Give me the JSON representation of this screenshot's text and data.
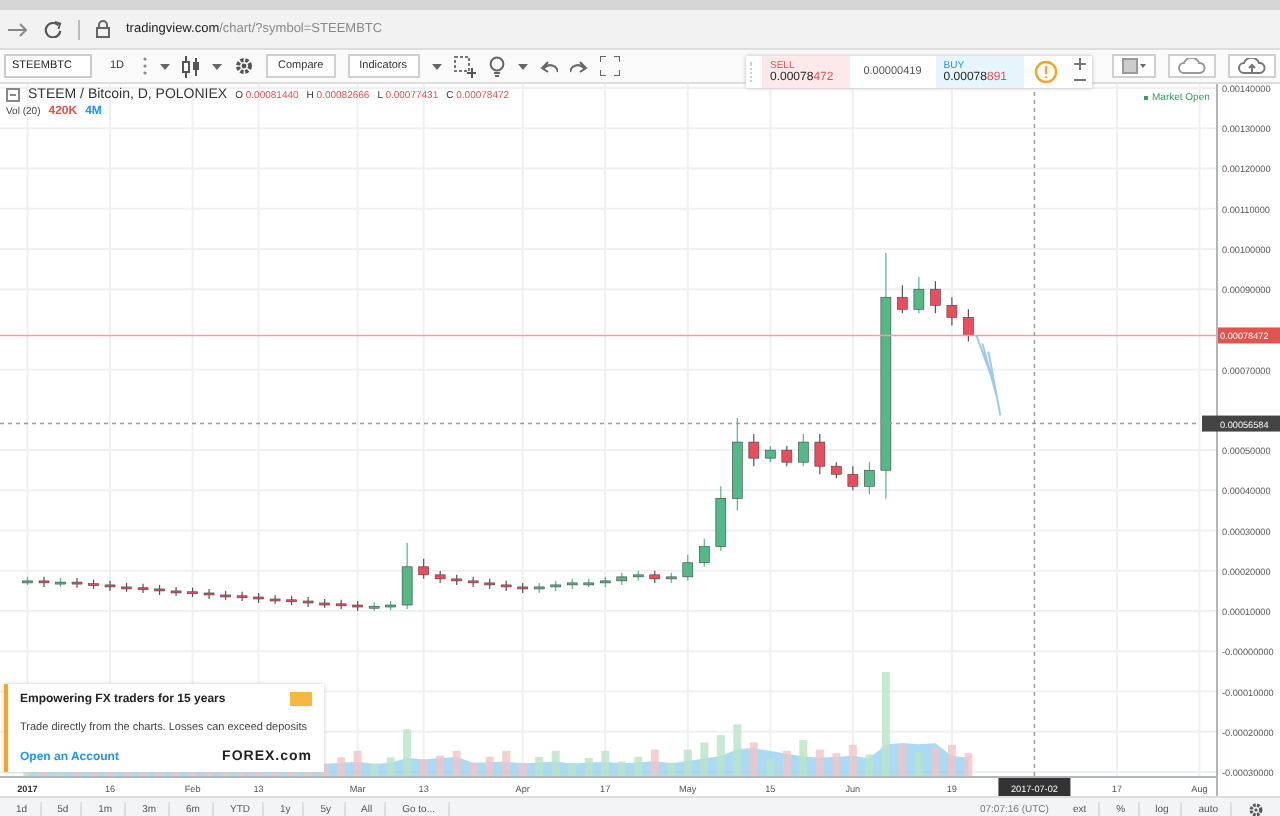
{
  "browser": {
    "domain": "tradingview.com",
    "path": "/chart/?symbol=STEEMBTC"
  },
  "toolbar": {
    "symbol": "STEEMBTC",
    "interval": "1D",
    "buttons": [
      "Compare",
      "Indicators"
    ]
  },
  "trade_widget": {
    "sell": {
      "label": "SELL",
      "price_main": "0.00078",
      "price_pips": "472"
    },
    "spread": "0.00000419",
    "buy": {
      "label": "BUY",
      "price_main": "0.00078",
      "price_pips": "891"
    }
  },
  "legend": {
    "title": "STEEM / Bitcoin, D, POLONIEX",
    "ohlc": [
      {
        "key": "O",
        "value": "0.00081440"
      },
      {
        "key": "H",
        "value": "0.00082666"
      },
      {
        "key": "L",
        "value": "0.00077431"
      },
      {
        "key": "C",
        "value": "0.00078472"
      }
    ],
    "volume_label": "Vol (20)",
    "volume_values": [
      {
        "text": "420K",
        "color": "#e0534f"
      },
      {
        "text": "4M",
        "color": "#2196f3"
      }
    ]
  },
  "market_status": "Market Open",
  "last_price_label": "0.00078472",
  "crosshair": {
    "price": "0.00056584",
    "date": "2017-07-02"
  },
  "chart_data": {
    "type": "candlestick",
    "ylim": [
      -0.00031,
      0.00141
    ],
    "grid": true,
    "ref_lines": [
      {
        "axis": "y",
        "value": 0.000785,
        "color": "#f0a0a0"
      },
      {
        "axis": "y",
        "value": 0.000566,
        "color": "#999999"
      }
    ],
    "categories": [
      "2017",
      null,
      null,
      null,
      null,
      "16",
      null,
      null,
      null,
      null,
      "Feb",
      null,
      null,
      null,
      "13",
      null,
      null,
      null,
      null,
      null,
      "Mar",
      null,
      null,
      null,
      "13",
      null,
      null,
      null,
      null,
      null,
      "Apr",
      null,
      null,
      null,
      null,
      "17",
      null,
      null,
      null,
      null,
      "May",
      null,
      null,
      null,
      null,
      "15",
      null,
      null,
      null,
      null,
      "Jun",
      null,
      null,
      null,
      null,
      null,
      "19",
      null,
      null,
      null,
      null,
      null,
      null,
      null,
      null,
      null,
      "17",
      null,
      null,
      null,
      null,
      "Aug"
    ],
    "ohlc": [
      [
        0.000175,
        0.000185,
        0.000165,
        0.000175
      ],
      [
        0.000175,
        0.000185,
        0.00016,
        0.00017
      ],
      [
        0.00017,
        0.000182,
        0.00016,
        0.000172
      ],
      [
        0.000172,
        0.000182,
        0.000158,
        0.000168
      ],
      [
        0.000168,
        0.000178,
        0.000155,
        0.000165
      ],
      [
        0.000165,
        0.000175,
        0.00015,
        0.00016
      ],
      [
        0.00016,
        0.00017,
        0.000148,
        0.000158
      ],
      [
        0.000158,
        0.000168,
        0.000145,
        0.000155
      ],
      [
        0.000155,
        0.000165,
        0.00014,
        0.00015
      ],
      [
        0.00015,
        0.00016,
        0.000138,
        0.000148
      ],
      [
        0.000148,
        0.000158,
        0.000135,
        0.000145
      ],
      [
        0.000145,
        0.000155,
        0.00013,
        0.00014
      ],
      [
        0.00014,
        0.00015,
        0.000128,
        0.000138
      ],
      [
        0.000138,
        0.000148,
        0.000125,
        0.000135
      ],
      [
        0.000135,
        0.000145,
        0.00012,
        0.00013
      ],
      [
        0.00013,
        0.00014,
        0.000118,
        0.000128
      ],
      [
        0.000128,
        0.000138,
        0.000115,
        0.000125
      ],
      [
        0.000125,
        0.000135,
        0.00011,
        0.00012
      ],
      [
        0.00012,
        0.00013,
        0.000108,
        0.000118
      ],
      [
        0.000118,
        0.000128,
        0.000105,
        0.000115
      ],
      [
        0.000115,
        0.000125,
        0.0001,
        0.00011
      ],
      [
        0.00011,
        0.000122,
        0.0001,
        0.000112
      ],
      [
        0.000112,
        0.000125,
        0.000102,
        0.000115
      ],
      [
        0.000115,
        0.00027,
        0.000105,
        0.00021
      ],
      [
        0.00021,
        0.00023,
        0.00018,
        0.00019
      ],
      [
        0.00019,
        0.0002,
        0.00017,
        0.00018
      ],
      [
        0.00018,
        0.00019,
        0.000165,
        0.000175
      ],
      [
        0.000175,
        0.000185,
        0.00016,
        0.00017
      ],
      [
        0.00017,
        0.00018,
        0.000155,
        0.000165
      ],
      [
        0.000165,
        0.000175,
        0.00015,
        0.00016
      ],
      [
        0.00016,
        0.00017,
        0.000145,
        0.000155
      ],
      [
        0.000155,
        0.00017,
        0.000145,
        0.00016
      ],
      [
        0.00016,
        0.000175,
        0.00015,
        0.000165
      ],
      [
        0.000165,
        0.00018,
        0.000155,
        0.00017
      ],
      [
        0.00017,
        0.00018,
        0.00016,
        0.00017
      ],
      [
        0.00017,
        0.000185,
        0.00016,
        0.000175
      ],
      [
        0.000175,
        0.000195,
        0.000165,
        0.000185
      ],
      [
        0.000185,
        0.0002,
        0.000175,
        0.00019
      ],
      [
        0.00019,
        0.0002,
        0.00017,
        0.00018
      ],
      [
        0.00018,
        0.000195,
        0.00017,
        0.000185
      ],
      [
        0.000185,
        0.00024,
        0.000175,
        0.00022
      ],
      [
        0.00022,
        0.00028,
        0.00021,
        0.00026
      ],
      [
        0.00026,
        0.00041,
        0.00025,
        0.00038
      ],
      [
        0.00038,
        0.00058,
        0.00035,
        0.00052
      ],
      [
        0.00052,
        0.00054,
        0.00046,
        0.00048
      ],
      [
        0.00048,
        0.00051,
        0.00047,
        0.0005
      ],
      [
        0.0005,
        0.00051,
        0.00046,
        0.00047
      ],
      [
        0.00047,
        0.00054,
        0.00046,
        0.00052
      ],
      [
        0.00052,
        0.00054,
        0.00044,
        0.00046
      ],
      [
        0.00046,
        0.00047,
        0.00043,
        0.00044
      ],
      [
        0.00044,
        0.00046,
        0.0004,
        0.00041
      ],
      [
        0.00041,
        0.00047,
        0.00039,
        0.00045
      ],
      [
        0.00045,
        0.00099,
        0.00038,
        0.00088
      ],
      [
        0.00088,
        0.00091,
        0.00084,
        0.00085
      ],
      [
        0.00085,
        0.00093,
        0.00084,
        0.0009
      ],
      [
        0.0009,
        0.00092,
        0.00084,
        0.00086
      ],
      [
        0.00086,
        0.00088,
        0.00081,
        0.00083
      ],
      [
        0.00083,
        0.00085,
        0.00077,
        0.000785
      ],
      null,
      null,
      null,
      null,
      null,
      null,
      null,
      null,
      null,
      null,
      null,
      null,
      null,
      null
    ],
    "yticks": [
      {
        "value": 0.0014,
        "label": "0.00140000"
      },
      {
        "value": 0.0013,
        "label": "0.00130000"
      },
      {
        "value": 0.0012,
        "label": "0.00120000"
      },
      {
        "value": 0.0011,
        "label": "0.00110000"
      },
      {
        "value": 0.001,
        "label": "0.00100000"
      },
      {
        "value": 0.0009,
        "label": "0.00090000"
      },
      {
        "value": 0.0007,
        "label": "0.00070000"
      },
      {
        "value": 0.0005,
        "label": "0.00050000"
      },
      {
        "value": 0.0004,
        "label": "0.00040000"
      },
      {
        "value": 0.0003,
        "label": "0.00030000"
      },
      {
        "value": 0.0002,
        "label": "0.00020000"
      },
      {
        "value": 0.0001,
        "label": "0.00010000"
      },
      {
        "value": 0,
        "label": "-0.00000000"
      },
      {
        "value": -0.0001,
        "label": "-0.00010000"
      },
      {
        "value": -0.0002,
        "label": "-0.00020000"
      },
      {
        "value": -0.0003,
        "label": "-0.00030000"
      }
    ]
  },
  "ad": {
    "headline": "Empowering FX traders for 15 years",
    "text": "Trade directly from the charts. Losses can exceed deposits",
    "link": "Open an Account",
    "brand": "FOREX.com"
  },
  "ranges": [
    "1d",
    "5d",
    "1m",
    "3m",
    "6m",
    "YTD",
    "1y",
    "5y",
    "All",
    "Go to..."
  ],
  "status": {
    "time": "07:07:16 (UTC)",
    "toggles": [
      "ext",
      "%",
      "log",
      "auto"
    ]
  }
}
